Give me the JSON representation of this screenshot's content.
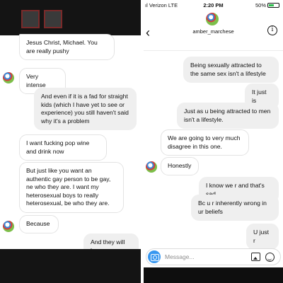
{
  "left": {
    "messages": [
      {
        "from": "them",
        "text": "Jesus Christ, Michael. You are really pushy"
      },
      {
        "from": "them",
        "text": "Very intense"
      },
      {
        "from": "me",
        "text": "And even if it is a fad for straight kids (which I have yet to see or experience) you still haven't said why it's a problem"
      },
      {
        "from": "them",
        "text": "I want fucking pop wine and drink now"
      },
      {
        "from": "them",
        "text": "But just like you want an authentic gay person to be gay, ne who they are. I want my heterosexual boys to really heterosexual,  be who they are."
      },
      {
        "from": "them",
        "text": "Because"
      },
      {
        "from": "me",
        "text": "And they will be"
      }
    ]
  },
  "right": {
    "status": {
      "carrier": "ıl Verizon  LTE",
      "time": "2:20 PM",
      "battery": "50%",
      "battery_level": 0.5
    },
    "header": {
      "username": "amber_marchese",
      "info_glyph": "i",
      "back_glyph": "‹"
    },
    "messages": [
      {
        "from": "me",
        "text": "Being sexually attracted to the same sex isn't a lifestyle"
      },
      {
        "from": "me",
        "text": "It just is"
      },
      {
        "from": "me",
        "text": "Just as u being attracted to men isn't a lifestyle."
      },
      {
        "from": "them",
        "text": "We are going to very much disagree in this one."
      },
      {
        "from": "them",
        "text": "Honestly"
      },
      {
        "from": "me",
        "text": "I know we r and that's sad"
      },
      {
        "from": "me",
        "text": "Bc u r inherently wrong in ur beliefs"
      },
      {
        "from": "me",
        "text": "U just r"
      }
    ],
    "composer": {
      "placeholder": "Message..."
    }
  },
  "colors": {
    "accent": "#3797f0",
    "outgoing_bubble": "#efefef",
    "incoming_border": "#e3e3e3"
  }
}
